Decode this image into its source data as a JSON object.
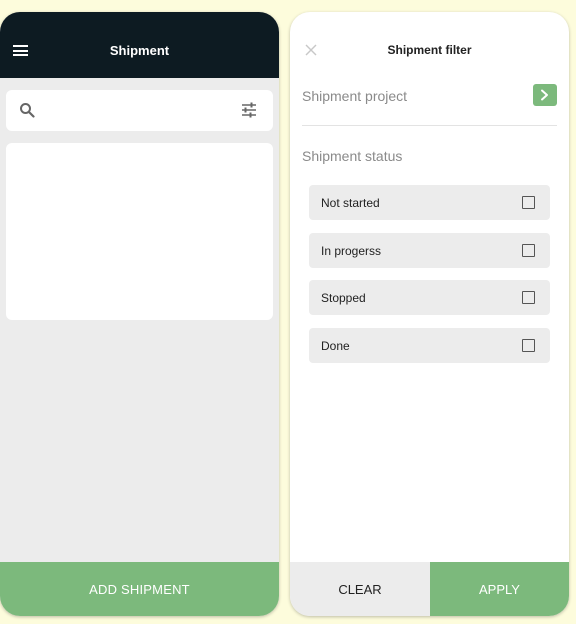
{
  "shipment_screen": {
    "title": "Shipment",
    "search": {
      "value": "",
      "placeholder": ""
    },
    "add_button_label": "ADD SHIPMENT"
  },
  "filter_screen": {
    "title": "Shipment filter",
    "project_section_label": "Shipment project",
    "status_section_label": "Shipment status",
    "statuses": [
      {
        "label": "Not started",
        "checked": false
      },
      {
        "label": "In progerss",
        "checked": false
      },
      {
        "label": "Stopped",
        "checked": false
      },
      {
        "label": "Done",
        "checked": false
      }
    ],
    "clear_label": "CLEAR",
    "apply_label": "APPLY"
  },
  "icons": {
    "menu": "menu-icon",
    "search": "search-icon",
    "filter": "tune-icon",
    "close": "close-icon",
    "chevron": "chevron-right-icon",
    "checkbox": "checkbox-icon"
  },
  "colors": {
    "page_background": "#fdfcdc",
    "app_bar": "#0d1b22",
    "accent_green": "#7cb97c",
    "screen_background": "#ececec",
    "card": "#ffffff"
  }
}
